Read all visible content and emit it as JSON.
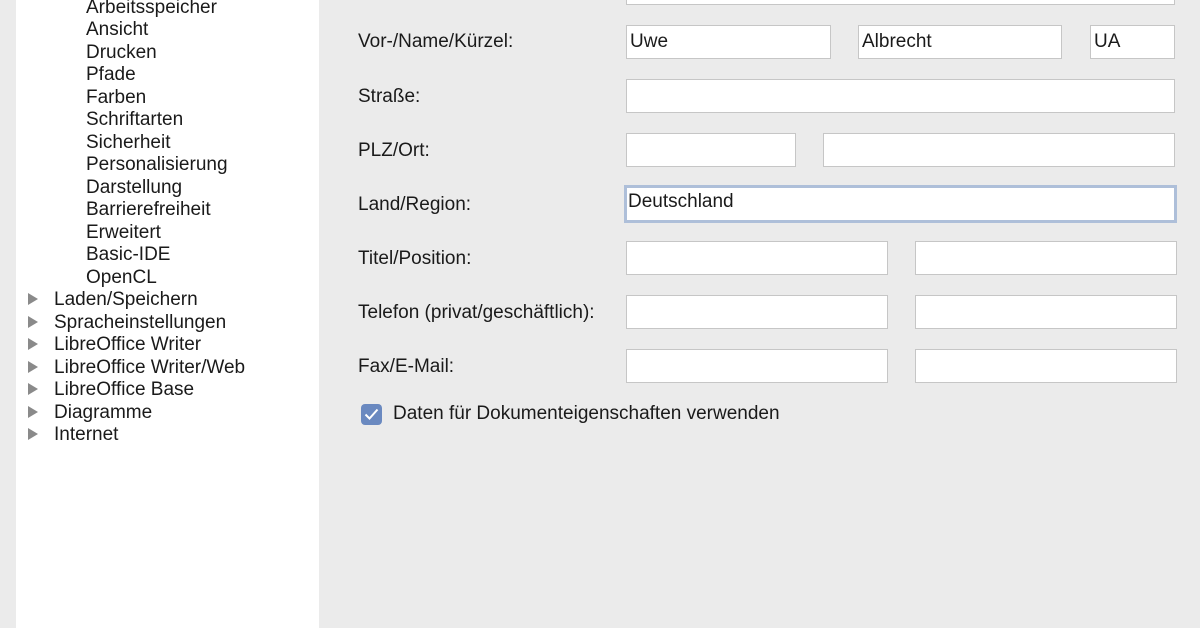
{
  "tree": {
    "children": [
      "Arbeitsspeicher",
      "Ansicht",
      "Drucken",
      "Pfade",
      "Farben",
      "Schriftarten",
      "Sicherheit",
      "Personalisierung",
      "Darstellung",
      "Barrierefreiheit",
      "Erweitert",
      "Basic-IDE",
      "OpenCL"
    ],
    "top_items": [
      "Laden/Speichern",
      "Spracheinstellungen",
      "LibreOffice Writer",
      "LibreOffice Writer/Web",
      "LibreOffice Base",
      "Diagramme",
      "Internet"
    ]
  },
  "form": {
    "name_label": "Vor-/Name/Kürzel:",
    "first_name": "Uwe",
    "last_name": "Albrecht",
    "initials": "UA",
    "street_label": "Straße:",
    "street": "",
    "zip_city_label": "PLZ/Ort:",
    "zip": "",
    "city": "",
    "country_label": "Land/Region:",
    "country": "Deutschland",
    "title_label": "Titel/Position:",
    "title": "",
    "position": "",
    "phone_label": "Telefon (privat/geschäftlich):",
    "phone_private": "",
    "phone_business": "",
    "fax_email_label": "Fax/E-Mail:",
    "fax": "",
    "email": "",
    "use_data_label": "Daten für Dokumenteigenschaften verwenden",
    "use_data_checked": true
  },
  "colors": {
    "accent": "#6a89c0",
    "focus_border": "#aebfd9",
    "panel_bg": "#ebebeb",
    "tree_bg": "#ffffff"
  }
}
